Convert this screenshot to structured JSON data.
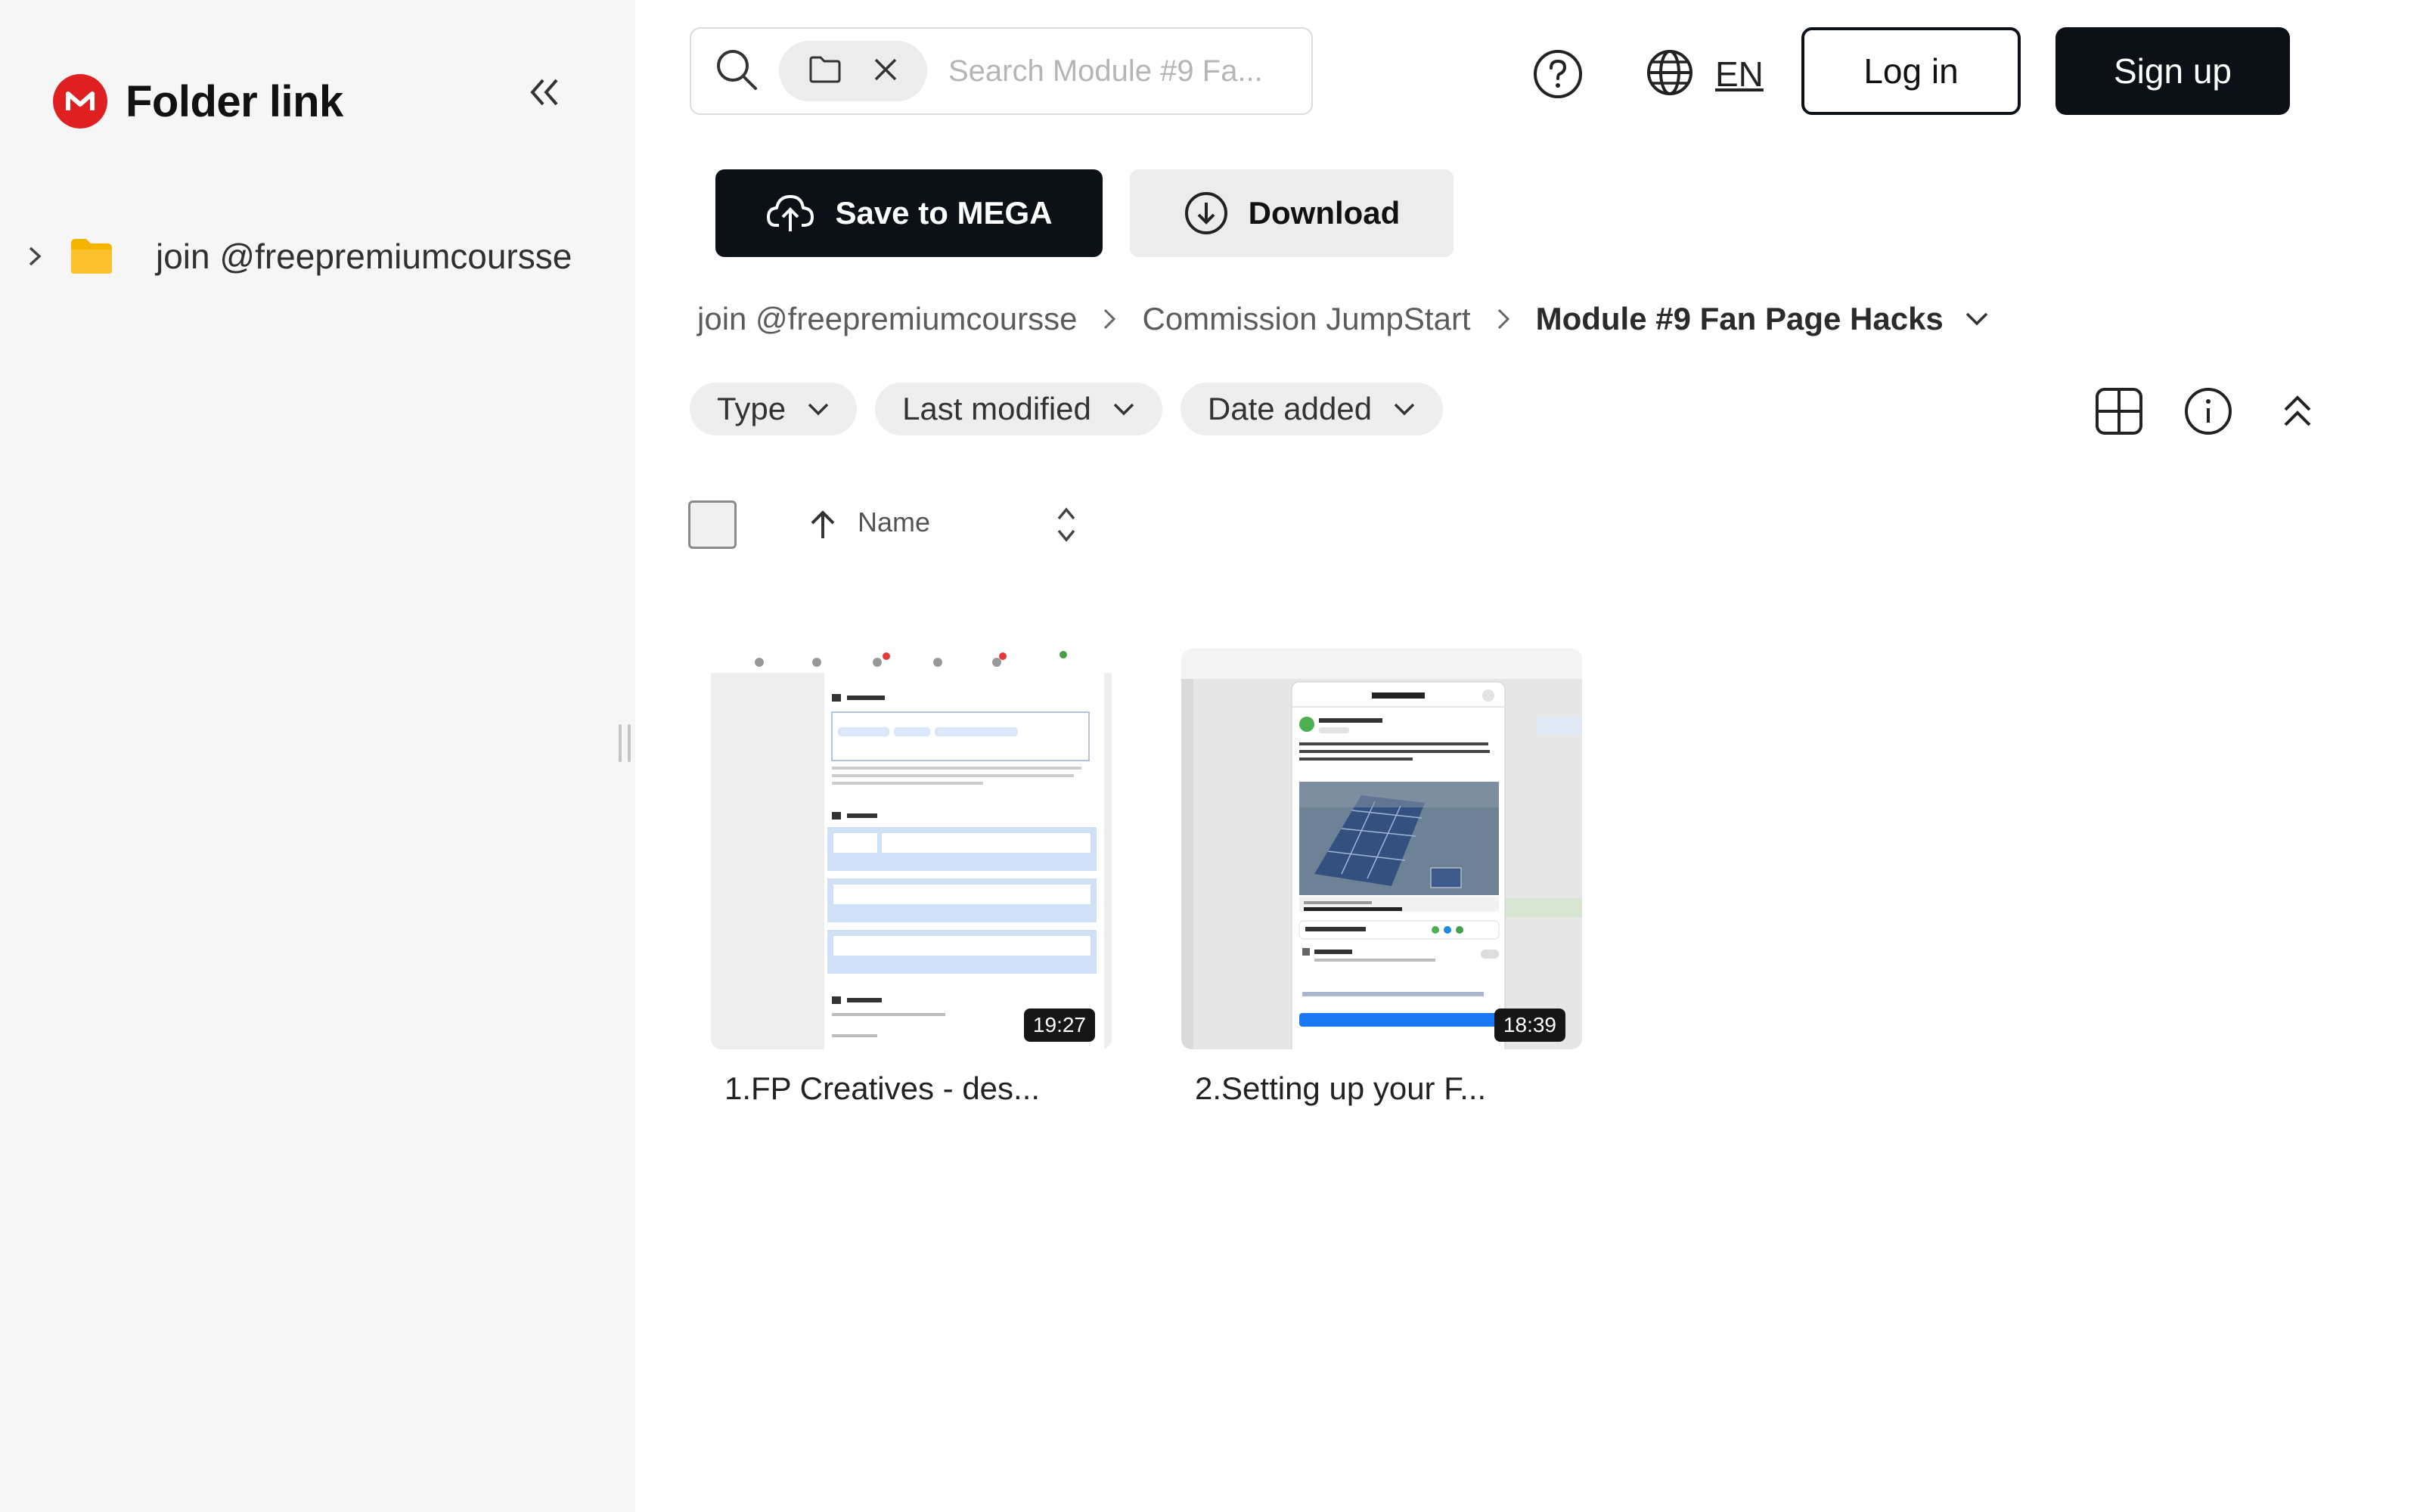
{
  "app": {
    "brand": "Folder link",
    "colors": {
      "brand_red": "#e02020",
      "dark": "#0c1118",
      "folder_yellow": "#f4b400"
    }
  },
  "sidebar": {
    "tree": [
      {
        "label": "join @freepremiumcoursse",
        "icon": "folder-icon"
      }
    ]
  },
  "header": {
    "search": {
      "placeholder": "Search Module #9 Fa..."
    },
    "language": "EN",
    "login": "Log in",
    "signup": "Sign up"
  },
  "actions": {
    "save": "Save to MEGA",
    "download": "Download"
  },
  "breadcrumb": {
    "items": [
      "join @freepremiumcoursse",
      "Commission JumpStart"
    ],
    "current": "Module #9 Fan Page Hacks"
  },
  "filters": [
    "Type",
    "Last modified",
    "Date added"
  ],
  "list": {
    "column_name": "Name"
  },
  "files": [
    {
      "name": "1.FP Creatives - des...",
      "duration": "19:27"
    },
    {
      "name": "2.Setting up your F...",
      "duration": "18:39"
    }
  ]
}
